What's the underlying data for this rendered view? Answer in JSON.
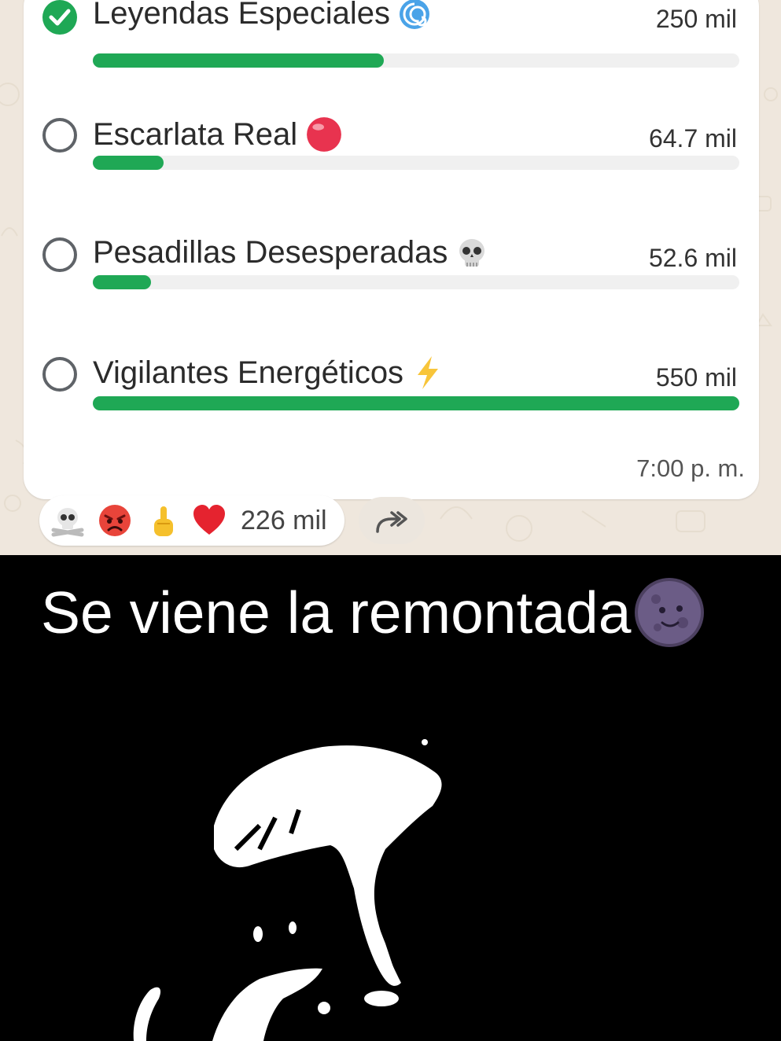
{
  "poll": {
    "options": [
      {
        "label": "Leyendas Especiales",
        "emoji": "cyclone-emoji",
        "count": "250 mil",
        "fraction": 0.45,
        "selected": true
      },
      {
        "label": "Escarlata Real",
        "emoji": "red-circle-emoji",
        "count": "64.7 mil",
        "fraction": 0.11,
        "selected": false
      },
      {
        "label": "Pesadillas Desesperadas",
        "emoji": "skull-emoji",
        "count": "52.6 mil",
        "fraction": 0.09,
        "selected": false
      },
      {
        "label": "Vigilantes Energéticos",
        "emoji": "lightning-emoji",
        "count": "550 mil",
        "fraction": 1.0,
        "selected": false
      }
    ],
    "time": "7:00 p. m."
  },
  "reactions": {
    "emojis": [
      "skull-crossbones-emoji",
      "angry-face-emoji",
      "middle-finger-emoji",
      "red-heart-emoji"
    ],
    "count": "226 mil"
  },
  "caption": {
    "text": "Se viene la remontada",
    "emoji": "new-moon-face-emoji"
  },
  "colors": {
    "accent": "#1fa855",
    "chat_background": "#efe7dd"
  }
}
